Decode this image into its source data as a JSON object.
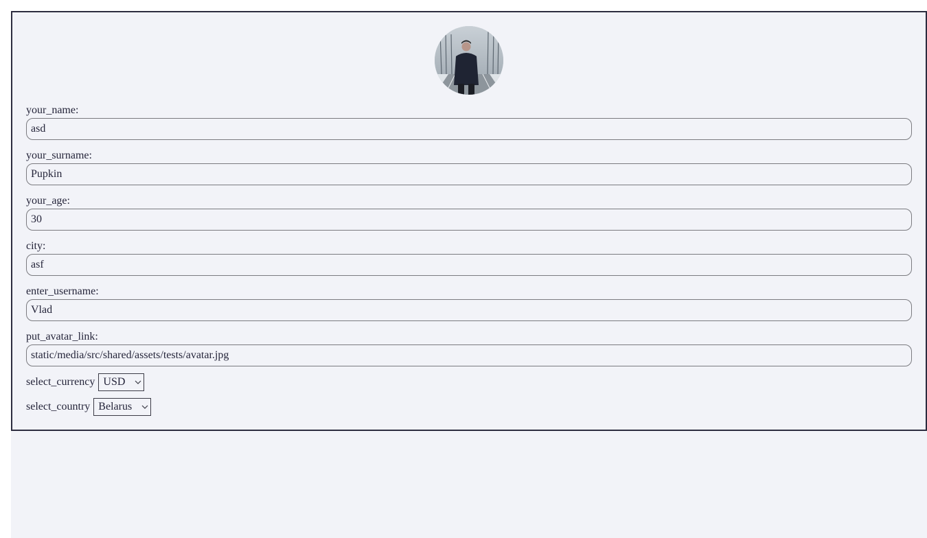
{
  "form": {
    "fields": [
      {
        "label": "your_name:",
        "value": "asd"
      },
      {
        "label": "your_surname:",
        "value": "Pupkin"
      },
      {
        "label": "your_age:",
        "value": "30"
      },
      {
        "label": "city:",
        "value": "asf"
      },
      {
        "label": "enter_username:",
        "value": "Vlad"
      },
      {
        "label": "put_avatar_link:",
        "value": "static/media/src/shared/assets/tests/avatar.jpg"
      }
    ],
    "currency": {
      "label": "select_currency",
      "selected": "USD"
    },
    "country": {
      "label": "select_country",
      "selected": "Belarus"
    }
  },
  "avatar": {
    "icon": "avatar-photo"
  },
  "colors": {
    "page_background": "#f2f3f8",
    "card_border": "#2c2c3f",
    "text": "#25253a",
    "input_border": "#7a7a7f"
  }
}
